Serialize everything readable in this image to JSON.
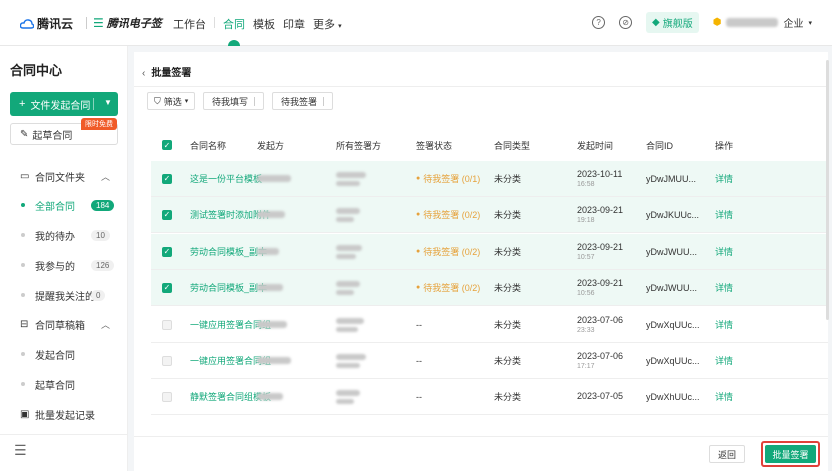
{
  "brand": {
    "name1": "腾讯云",
    "name2": "腾讯电子签"
  },
  "nav": {
    "items": [
      "工作台",
      "合同",
      "模板",
      "印章",
      "更多"
    ],
    "active": "合同"
  },
  "header_right": {
    "edition": "旗舰版",
    "company_suffix": "企业"
  },
  "sidebar": {
    "title": "合同中心",
    "start_button": "文件发起合同",
    "draft_button": "起草合同",
    "promo_badge": "限时免费",
    "folder_title": "合同文件夹",
    "items": [
      {
        "label": "全部合同",
        "count": "184",
        "active": true
      },
      {
        "label": "我的待办",
        "count": "10"
      },
      {
        "label": "我参与的",
        "count": "126"
      },
      {
        "label": "提醒我关注的",
        "count": "0"
      }
    ],
    "draft_box_title": "合同草稿箱",
    "draft_items": [
      "发起合同",
      "起草合同"
    ],
    "batch_record": "批量发起记录"
  },
  "main": {
    "breadcrumb": "批量签署",
    "filter_label": "筛选",
    "chips": [
      "待我填写",
      "待我签署"
    ],
    "columns": [
      "合同名称",
      "发起方",
      "所有签署方",
      "签署状态",
      "合同类型",
      "发起时间",
      "合同ID",
      "操作"
    ],
    "rows": [
      {
        "checked": true,
        "name": "这是一份平台模板",
        "status": "待我签署 (0/1)",
        "type": "未分类",
        "date": "2023-10-11",
        "time": "16:58",
        "id": "yDwJMUU...",
        "action": "详情"
      },
      {
        "checked": true,
        "name": "测试签署时添加附件",
        "status": "待我签署 (0/2)",
        "type": "未分类",
        "date": "2023-09-21",
        "time": "19:18",
        "id": "yDwJKUUc...",
        "action": "详情"
      },
      {
        "checked": true,
        "name": "劳动合同模板_副本",
        "status": "待我签署 (0/2)",
        "type": "未分类",
        "date": "2023-09-21",
        "time": "10:57",
        "id": "yDwJWUU...",
        "action": "详情"
      },
      {
        "checked": true,
        "name": "劳动合同模板_副本",
        "status": "待我签署 (0/2)",
        "type": "未分类",
        "date": "2023-09-21",
        "time": "10:56",
        "id": "yDwJWUU...",
        "action": "详情"
      },
      {
        "checked": false,
        "name": "一键应用签署合同组",
        "status": "--",
        "type": "未分类",
        "date": "2023-07-06",
        "time": "23:33",
        "id": "yDwXqUUc...",
        "action": "详情"
      },
      {
        "checked": false,
        "name": "一键应用签署合同组",
        "status": "--",
        "type": "未分类",
        "date": "2023-07-06",
        "time": "17:17",
        "id": "yDwXqUUc...",
        "action": "详情"
      },
      {
        "checked": false,
        "name": "静默签署合同组模板",
        "status": "--",
        "type": "未分类",
        "date": "2023-07-05",
        "time": "",
        "id": "yDwXhUUc...",
        "action": "详情"
      }
    ],
    "back_button": "返回",
    "batch_button": "批量签署"
  },
  "colors": {
    "accent": "#12a87a",
    "warning": "#e6a23c",
    "highlight": "#e0413a"
  }
}
